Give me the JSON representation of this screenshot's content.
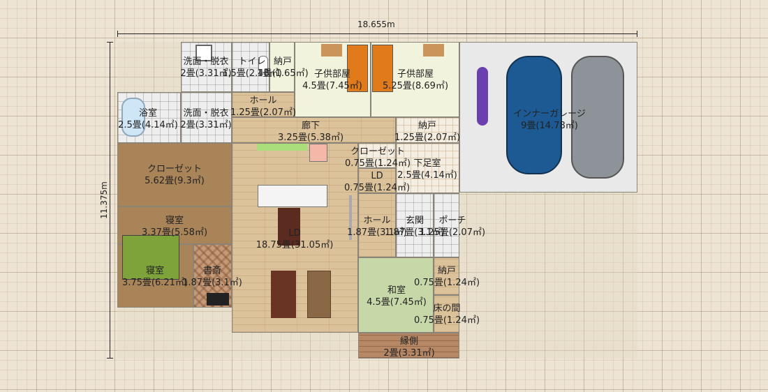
{
  "dimensions": {
    "width": "18.655m",
    "height": "11.375m"
  },
  "rooms": {
    "wash_top": {
      "name": "洗面・脱衣",
      "area": "2畳(3.31㎡)"
    },
    "toilet": {
      "name": "トイレ",
      "area": "1.5畳(2.48㎡)"
    },
    "storage_top": {
      "name": "納戸",
      "area": "1畳(1.65㎡)"
    },
    "kids1": {
      "name": "子供部屋",
      "area": "4.5畳(7.45㎡)"
    },
    "kids2": {
      "name": "子供部屋",
      "area": "5.25畳(8.69㎡)"
    },
    "bath": {
      "name": "浴室",
      "area": "2.5畳(4.14㎡)"
    },
    "wash_mid": {
      "name": "洗面・脱衣",
      "area": "2畳(3.31㎡)"
    },
    "hall_top": {
      "name": "ホール",
      "area": "1.25畳(2.07㎡)"
    },
    "corridor": {
      "name": "廊下",
      "area": "3.25畳(5.38㎡)"
    },
    "storage_mid": {
      "name": "納戸",
      "area": "1.25畳(2.07㎡)"
    },
    "garage": {
      "name": "インナーガレージ",
      "area": "9畳(14.78㎡)"
    },
    "closet_ld": {
      "name": "クローゼット",
      "area": "0.75畳(1.24㎡)"
    },
    "shoes": {
      "name": "下足室",
      "area": "2.5畳(4.14㎡)"
    },
    "ld_small": {
      "name": "LD",
      "area": "0.75畳(1.24㎡)"
    },
    "closet_big": {
      "name": "クローゼット",
      "area": "5.62畳(9.3㎡)"
    },
    "bed1": {
      "name": "寝室",
      "area": "3.37畳(5.58㎡)"
    },
    "ld": {
      "name": "LD",
      "area": "18.75畳(31.05㎡)"
    },
    "hall_entry": {
      "name": "ホール",
      "area": "1.87畳(3.1㎡)"
    },
    "genkan": {
      "name": "玄関",
      "area": "1.87畳(3.1㎡)"
    },
    "porch": {
      "name": "ポーチ",
      "area": "1.25畳(2.07㎡)"
    },
    "bed2": {
      "name": "寝室",
      "area": "3.75畳(6.21㎡)"
    },
    "study": {
      "name": "書斎",
      "area": "1.87畳(3.1㎡)"
    },
    "washitsu": {
      "name": "和室",
      "area": "4.5畳(7.45㎡)"
    },
    "storage_jp": {
      "name": "納戸",
      "area": "0.75畳(1.24㎡)"
    },
    "tokonoma": {
      "name": "床の間",
      "area": "0.75畳(1.24㎡)"
    },
    "engawa": {
      "name": "縁側",
      "area": "2畳(3.31㎡)"
    }
  },
  "colors": {
    "car1": "#1d5a93",
    "car2": "#8e9399",
    "moto": "#6a3fb0"
  }
}
